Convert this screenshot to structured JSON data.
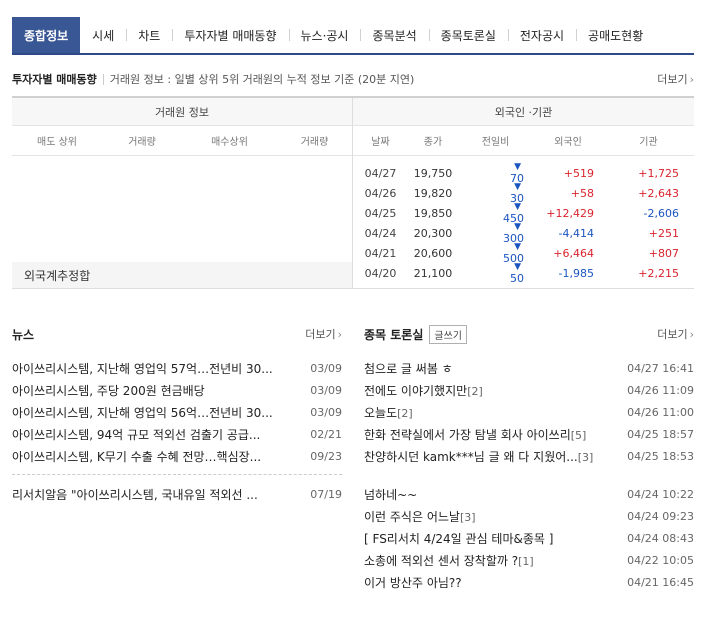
{
  "tabs": [
    "종합정보",
    "시세",
    "차트",
    "투자자별 매매동향",
    "뉴스·공시",
    "종목분석",
    "종목토론실",
    "전자공시",
    "공매도현황"
  ],
  "investor": {
    "title": "투자자별 매매동향",
    "desc": "거래원 정보 : 일별 상위 5위 거래원의 누적 정보 기준 (20분 지연)",
    "more": "더보기",
    "broker_head": "거래원 정보",
    "foreign_head": "외국인 ·기관",
    "broker_cols": [
      "매도 상위",
      "거래량",
      "매수상위",
      "거래량"
    ],
    "foreign_cols": [
      "날짜",
      "종가",
      "전일비",
      "외국인",
      "기관"
    ],
    "foreign_total_label": "외국계추정합",
    "rows": [
      {
        "date": "04/27",
        "close": "19,750",
        "change": "70",
        "foreign": "+519",
        "inst": "+1,725"
      },
      {
        "date": "04/26",
        "close": "19,820",
        "change": "30",
        "foreign": "+58",
        "inst": "+2,643"
      },
      {
        "date": "04/25",
        "close": "19,850",
        "change": "450",
        "foreign": "+12,429",
        "inst": "-2,606"
      },
      {
        "date": "04/24",
        "close": "20,300",
        "change": "300",
        "foreign": "-4,414",
        "inst": "+251"
      },
      {
        "date": "04/21",
        "close": "20,600",
        "change": "500",
        "foreign": "+6,464",
        "inst": "+807"
      },
      {
        "date": "04/20",
        "close": "21,100",
        "change": "50",
        "foreign": "-1,985",
        "inst": "+2,215"
      }
    ]
  },
  "news": {
    "title": "뉴스",
    "more": "더보기",
    "items": [
      {
        "title": "아이쓰리시스템, 지난해 영업익 57억…전년비 30...",
        "date": "03/09"
      },
      {
        "title": "아이쓰리시스템, 주당 200원 현금배당",
        "date": "03/09"
      },
      {
        "title": "아이쓰리시스템, 지난해 영업익 56억…전년비 30...",
        "date": "03/09"
      },
      {
        "title": "아이쓰리시스템, 94억 규모 적외선 검출기 공급...",
        "date": "02/21"
      },
      {
        "title": "아이쓰리시스템, K무기 수출 수혜 전망…핵심장...",
        "date": "09/23"
      }
    ],
    "research": {
      "title": "리서치알음 \"아이쓰리시스템, 국내유일 적외선 ...",
      "date": "07/19"
    }
  },
  "board": {
    "title": "종목 토론실",
    "write_label": "글쓰기",
    "more": "더보기",
    "items": [
      {
        "title": "첨으로 글 써봄 ㅎ",
        "count": "",
        "date": "04/27 16:41"
      },
      {
        "title": "전에도 이야기했지만",
        "count": "[2]",
        "date": "04/26 11:09"
      },
      {
        "title": "오늘도",
        "count": "[2]",
        "date": "04/26 11:00"
      },
      {
        "title": "한화 전략실에서 가장 탐낼 회사 아이쓰리",
        "count": "[5]",
        "date": "04/25 18:57"
      },
      {
        "title": "찬양하시던 kamk***님 글 왜 다 지웠어...",
        "count": "[3]",
        "date": "04/25 18:53"
      }
    ],
    "items2": [
      {
        "title": "넘하네~~",
        "count": "",
        "date": "04/24 10:22"
      },
      {
        "title": "이런 주식은 어느날",
        "count": "[3]",
        "date": "04/24 09:23"
      },
      {
        "title": "[ FS리서치 4/24일 관심 테마&종목 ]",
        "count": "",
        "date": "04/24 08:43"
      },
      {
        "title": "소총에 적외선 센서 장착할까 ?",
        "count": "[1]",
        "date": "04/22 10:05"
      },
      {
        "title": "이거 방산주 아님??",
        "count": "",
        "date": "04/21 16:45"
      }
    ]
  }
}
